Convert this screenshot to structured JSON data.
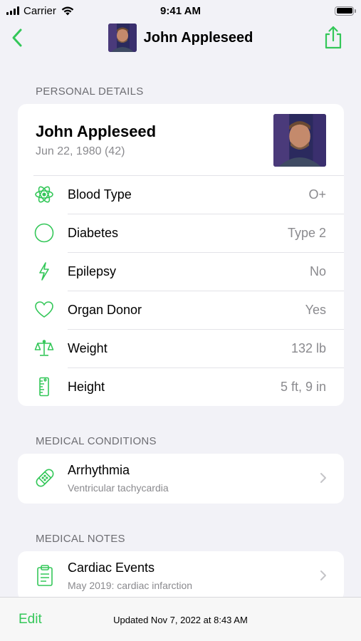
{
  "status_bar": {
    "carrier": "Carrier",
    "time": "9:41 AM"
  },
  "nav": {
    "title": "John Appleseed"
  },
  "personal": {
    "header": "PERSONAL DETAILS",
    "name": "John Appleseed",
    "dob": "Jun 22, 1980 (42)",
    "rows": [
      {
        "label": "Blood Type",
        "value": "O+",
        "icon": "atom-icon"
      },
      {
        "label": "Diabetes",
        "value": "Type 2",
        "icon": "circle-icon"
      },
      {
        "label": "Epilepsy",
        "value": "No",
        "icon": "bolt-icon"
      },
      {
        "label": "Organ Donor",
        "value": "Yes",
        "icon": "heart-icon"
      },
      {
        "label": "Weight",
        "value": "132 lb",
        "icon": "scale-icon"
      },
      {
        "label": "Height",
        "value": "5 ft, 9 in",
        "icon": "ruler-icon"
      }
    ]
  },
  "conditions": {
    "header": "MEDICAL CONDITIONS",
    "items": [
      {
        "title": "Arrhythmia",
        "subtitle": "Ventricular tachycardia",
        "icon": "bandage-icon"
      }
    ]
  },
  "notes": {
    "header": "MEDICAL NOTES",
    "items": [
      {
        "title": "Cardiac Events",
        "subtitle": "May 2019: cardiac infarction",
        "icon": "clipboard-icon"
      }
    ]
  },
  "toolbar": {
    "edit_label": "Edit",
    "updated_text": "Updated Nov 7, 2022 at 8:43 AM"
  },
  "colors": {
    "accent": "#34c759",
    "background": "#f2f2f7",
    "secondary_text": "#8a8a8e"
  }
}
